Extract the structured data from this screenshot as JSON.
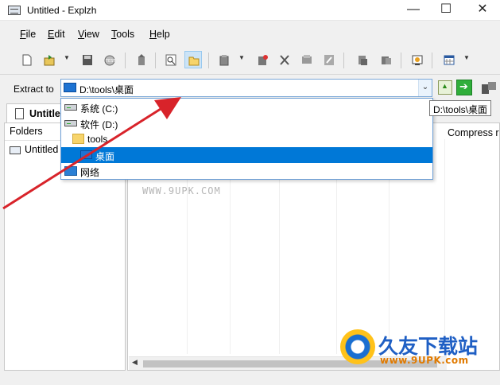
{
  "window": {
    "title": "Untitled - Explzh",
    "minimize": "—",
    "maximize": "☐",
    "close": "✕"
  },
  "menu": [
    {
      "pre": "",
      "ul": "F",
      "post": "ile"
    },
    {
      "pre": "",
      "ul": "E",
      "post": "dit"
    },
    {
      "pre": "",
      "ul": "V",
      "post": "iew"
    },
    {
      "pre": "",
      "ul": "T",
      "post": "ools"
    },
    {
      "pre": "",
      "ul": "H",
      "post": "elp"
    }
  ],
  "toolbar": {
    "icons": [
      "new-archive-icon",
      "open-archive-icon",
      "save-icon",
      "test-icon",
      "extract-icon",
      "view-icon",
      "open-folder-icon",
      "add-files-icon",
      "add-icon",
      "delete-icon",
      "properties-icon",
      "edit-icon",
      "copy-icon",
      "move-icon",
      "wizard-icon",
      "view-mode-icon"
    ],
    "selected": "open-folder-icon"
  },
  "extract": {
    "label": "Extract to",
    "path": "D:\\tools\\桌面",
    "tooltip": "D:\\tools\\桌面"
  },
  "dropdown": {
    "items": [
      {
        "label": "系统 (C:)",
        "icon": "drive-icon",
        "level": 0
      },
      {
        "label": "软件 (D:)",
        "icon": "drive-icon",
        "level": 0
      },
      {
        "label": "tools",
        "icon": "folder-icon",
        "level": 1
      },
      {
        "label": "桌面",
        "icon": "desktop-icon",
        "level": 2,
        "selected": true
      },
      {
        "label": "网络",
        "icon": "network-icon",
        "level": 0
      }
    ]
  },
  "tabs": [
    {
      "label": "Untitle"
    }
  ],
  "folders_pane": {
    "header": "Folders",
    "items": [
      {
        "label": "Untitled"
      }
    ]
  },
  "files_pane": {
    "column_compress": "Compress r",
    "watermark": "WWW.9UPK.COM"
  },
  "brand": {
    "name": "久友下载站",
    "url": "www.9UPK.com"
  },
  "colors": {
    "selection": "#0078d7",
    "arrow": "#d8232a"
  }
}
